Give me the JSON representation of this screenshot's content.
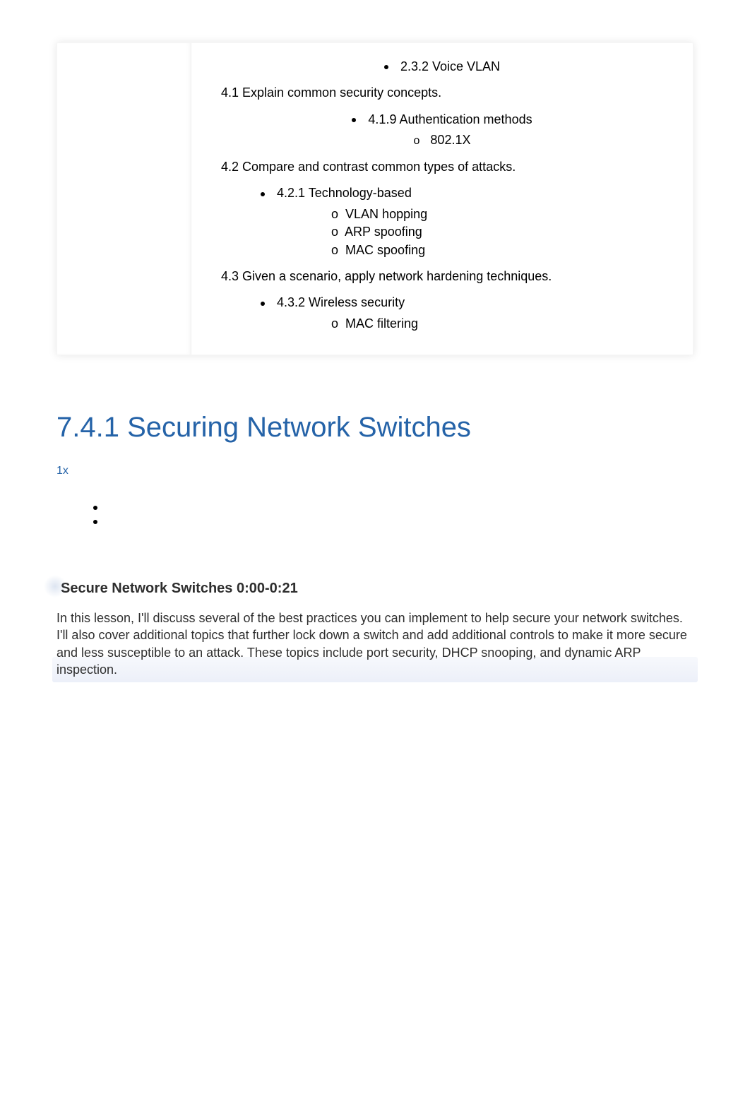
{
  "objectives": {
    "item_2_3_2": "2.3.2 Voice VLAN",
    "sec_4_1": "4.1 Explain common security concepts.",
    "item_4_1_9": "4.1.9 Authentication methods",
    "sub_4_1_9_a": "802.1X",
    "sec_4_2": "4.2 Compare and contrast common types of attacks.",
    "item_4_2_1": "4.2.1 Technology-based",
    "sub_4_2_1_a": "VLAN hopping",
    "sub_4_2_1_b": "ARP spoofing",
    "sub_4_2_1_c": "MAC spoofing",
    "sec_4_3": "4.3 Given a scenario, apply network hardening techniques.",
    "item_4_3_2": "4.3.2 Wireless security",
    "sub_4_3_2_a": "MAC filtering"
  },
  "page": {
    "title": "7.4.1 Securing Network Switches",
    "speed": "1x",
    "section_heading": "Secure Network Switches 0:00-0:21",
    "body_text": "In this lesson, I'll discuss several of the best practices you can implement to help secure your network switches. I'll also cover additional topics that further lock down a switch and add additional controls to make it more secure and less susceptible to an attack. These topics include port security, DHCP snooping, and dynamic ARP inspection."
  },
  "o_label": "o"
}
